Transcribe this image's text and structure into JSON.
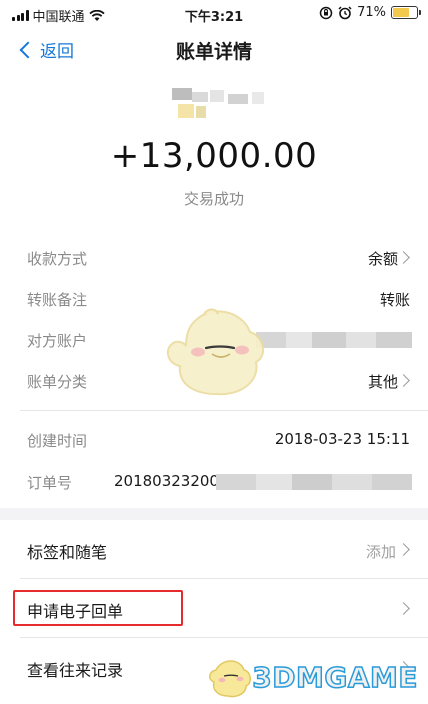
{
  "status_bar": {
    "carrier": "中国联通",
    "time": "下午3:21",
    "battery_percent": "71%",
    "battery_level": 0.71
  },
  "nav": {
    "back_label": "返回",
    "title": "账单详情"
  },
  "summary": {
    "amount": "+13,000.00",
    "status": "交易成功"
  },
  "details": {
    "rows": [
      {
        "label": "收款方式",
        "value": "余额"
      },
      {
        "label": "转账备注",
        "value": "转账"
      },
      {
        "label": "对方账户",
        "value": ""
      },
      {
        "label": "账单分类",
        "value": "其他"
      },
      {
        "label": "创建时间",
        "value": "2018-03-23 15:11"
      },
      {
        "label": "订单号",
        "value": "20180323200"
      }
    ]
  },
  "menu": {
    "items": [
      {
        "label": "标签和随笔",
        "extra": "添加"
      },
      {
        "label": "申请电子回单",
        "extra": ""
      },
      {
        "label": "查看往来记录",
        "extra": ""
      }
    ]
  },
  "watermark": {
    "text": "3DMGAME"
  },
  "colors": {
    "accent": "#1677d9",
    "highlight": "#e52b2b",
    "background": "#f3f3f5"
  }
}
